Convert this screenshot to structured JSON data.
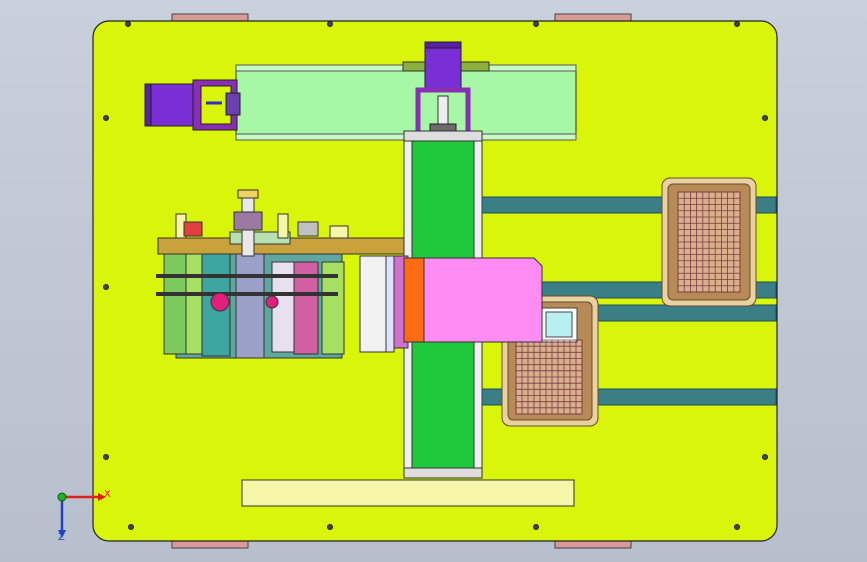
{
  "view": {
    "background": "#c3cad6",
    "colors": {
      "base_plate": "#d8f50a",
      "outline": "#1a1a1a",
      "rail_fill": "#a6f7a6",
      "column_fill": "#1fc93c",
      "motor": "#7a2fd6",
      "mount_purple": "#8a2fb3",
      "pink_block": "#ff8cf2",
      "orange_plate": "#ff6a12",
      "track_teal": "#3a7f86",
      "tray_frame": "#b88a55",
      "tray_grid": "#7a3a48",
      "bar_yellow": "#f6f5a8",
      "foot_pad": "#d89a9a",
      "beam_gold": "#c9a23c",
      "cyl_green": "#7cc95c",
      "cyl_magenta": "#d05fa3"
    }
  },
  "triad": {
    "x_label": "X",
    "y_label": "Y",
    "z_label": "Z",
    "x_color": "#e02020",
    "y_color": "#20b020",
    "z_color": "#2040d0"
  }
}
